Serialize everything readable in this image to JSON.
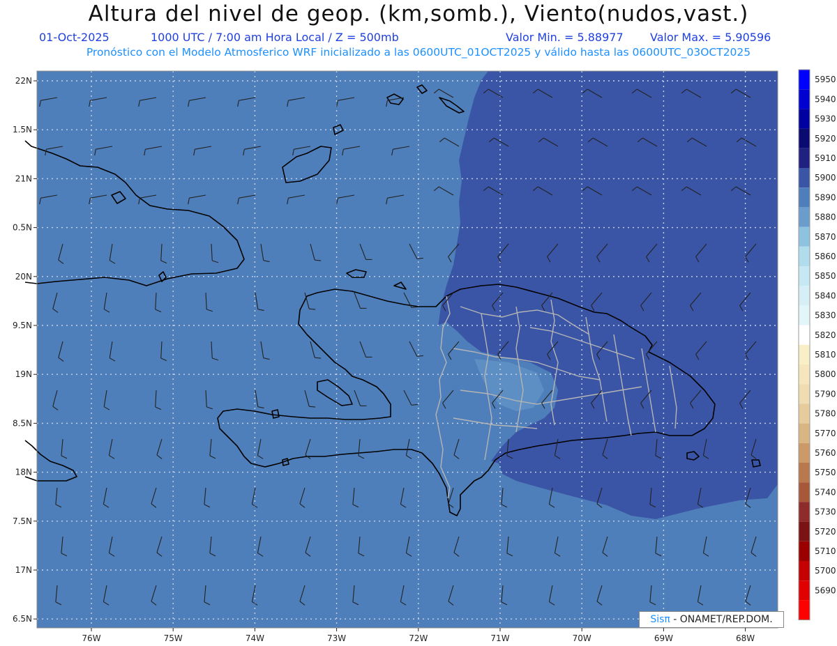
{
  "header": {
    "title": "Altura del nivel de geop. (km,somb.), Viento(nudos,vast.)",
    "date": "01-Oct-2025",
    "time_level": "1000 UTC / 7:00 am Hora Local / Z = 500mb",
    "min_label": "Valor Min. = 5.88977",
    "max_label": "Valor Max. = 5.90596",
    "subtitle": "Pronóstico con el Modelo Atmosferico WRF inicializado a las 0600UTC_01OCT2025 y válido hasta las  0600UTC_03OCT2025"
  },
  "axes": {
    "lat_labels": [
      "22N",
      "1.5N",
      "21N",
      "0.5N",
      "20N",
      "9.5N",
      "19N",
      "8.5N",
      "18N",
      "7.5N",
      "17N",
      "6.5N"
    ],
    "lon_labels": [
      "76W",
      "75W",
      "74W",
      "73W",
      "72W",
      "71W",
      "70W",
      "69W",
      "68W"
    ]
  },
  "colorbar": {
    "levels": [
      "5950",
      "5940",
      "5930",
      "5920",
      "5910",
      "5900",
      "5890",
      "5880",
      "5870",
      "5860",
      "5850",
      "5840",
      "5830",
      "5820",
      "5810",
      "5800",
      "5790",
      "5780",
      "5770",
      "5760",
      "5750",
      "5740",
      "5730",
      "5720",
      "5710",
      "5700",
      "5690"
    ],
    "colors": [
      "#0000ff",
      "#0000d0",
      "#0000a0",
      "#0a0a70",
      "#202080",
      "#3b55a6",
      "#4f7fba",
      "#6a9ccc",
      "#8ec3df",
      "#b0dcec",
      "#c6e8f2",
      "#d6eff7",
      "#e2f6fa",
      "#ffffff",
      "#f9efc6",
      "#f5e6bd",
      "#efdcb0",
      "#e6cb9c",
      "#dab584",
      "#cc9a68",
      "#b9794e",
      "#a75839",
      "#8e2b2b",
      "#7a1414",
      "#9a0000",
      "#c40000",
      "#e00000",
      "#ff0000"
    ]
  },
  "colors": {
    "field_main": "#4f7fba",
    "field_high": "#3b55a6",
    "field_low": "#6a9ccc",
    "coast": "#000000",
    "borders": "#b5b5b5"
  },
  "credit": {
    "sis": "Sisπ",
    "org": "- ONAMET/REP.DOM."
  }
}
